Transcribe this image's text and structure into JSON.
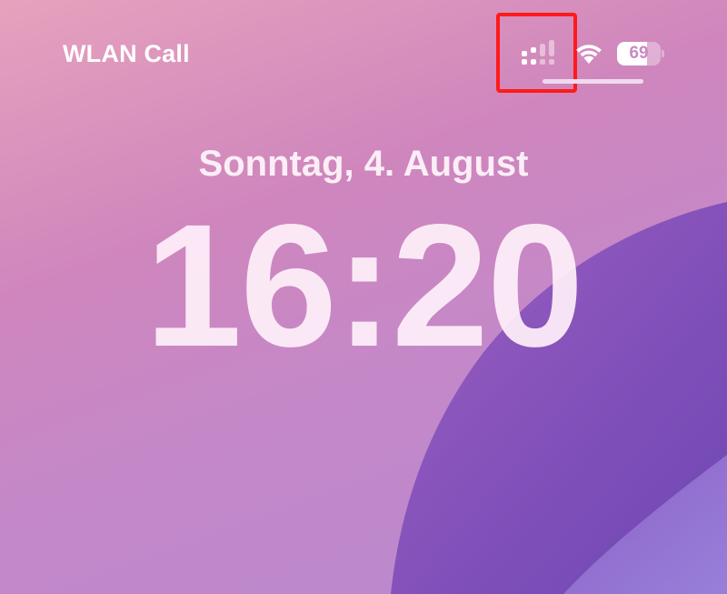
{
  "status_bar": {
    "carrier": "WLAN Call",
    "battery_level": "69",
    "battery_fraction": 0.69,
    "signal_icon": "cellular-signal-icon",
    "wifi_icon": "wifi-icon",
    "highlight_color": "#ff1a1a"
  },
  "lock_screen": {
    "date": "Sonntag, 4. August",
    "time": "16:20"
  }
}
